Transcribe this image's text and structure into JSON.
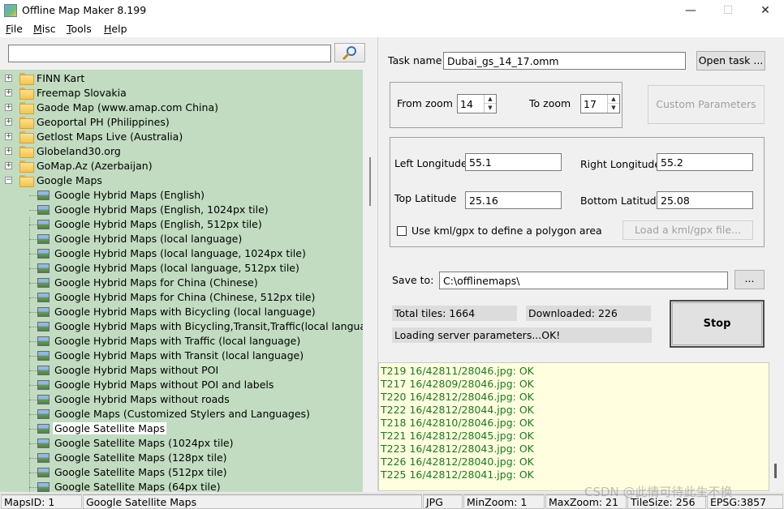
{
  "window": {
    "title": "Offline Map Maker 8.199",
    "minimize": "—",
    "maximize": "☐",
    "close": "✕"
  },
  "menu": [
    {
      "label": "File",
      "accel": "F",
      "rest": "ile"
    },
    {
      "label": "Misc",
      "accel": "M",
      "rest": "isc"
    },
    {
      "label": "Tools",
      "accel": "T",
      "rest": "ools"
    },
    {
      "label": "Help",
      "accel": "H",
      "rest": "elp"
    }
  ],
  "search": {
    "value": "",
    "button_icon": "magnifier-icon"
  },
  "tree": {
    "folders": [
      {
        "label": "FINN Kart",
        "expander": "+"
      },
      {
        "label": "Freemap Slovakia",
        "expander": "+"
      },
      {
        "label": "Gaode Map (www.amap.com China)",
        "expander": "+"
      },
      {
        "label": "Geoportal PH (Philippines)",
        "expander": "+"
      },
      {
        "label": "Getlost Maps Live (Australia)",
        "expander": "+"
      },
      {
        "label": "Globeland30.org",
        "expander": "+"
      },
      {
        "label": "GoMap.Az (Azerbaijan)",
        "expander": "+"
      },
      {
        "label": "Google Maps",
        "expander": "−"
      }
    ],
    "items": [
      "Google Hybrid Maps (English)",
      "Google Hybrid Maps (English, 1024px tile)",
      "Google Hybrid Maps (English, 512px tile)",
      "Google Hybrid Maps (local language)",
      "Google Hybrid Maps (local language, 1024px tile)",
      "Google Hybrid Maps (local language, 512px tile)",
      "Google Hybrid Maps for China (Chinese)",
      "Google Hybrid Maps for China (Chinese, 512px tile)",
      "Google Hybrid Maps with Bicycling (local language)",
      "Google Hybrid Maps with Bicycling,Transit,Traffic(local language)",
      "Google Hybrid Maps with Traffic (local language)",
      "Google Hybrid Maps with Transit (local language)",
      "Google Hybrid Maps without POI",
      "Google Hybrid Maps without POI and labels",
      "Google Hybrid Maps without roads",
      "Google Maps (Customized Stylers and Languages)",
      "Google Satellite Maps",
      "Google Satellite Maps (1024px tile)",
      "Google Satellite Maps (128px tile)",
      "Google Satellite Maps (512px tile)",
      "Google Satellite Maps (64px tile)"
    ],
    "selected": "Google Satellite Maps"
  },
  "task": {
    "name_label": "Task name",
    "name_value": "Dubai_gs_14_17.omm",
    "open_button": "Open task ..."
  },
  "zoom": {
    "from_label": "From zoom",
    "from_value": "14",
    "to_label": "To zoom",
    "to_value": "17",
    "custom_button": "Custom Parameters"
  },
  "area": {
    "left_lon_label": "Left Longitude",
    "left_lon_value": "55.1",
    "right_lon_label": "Right Longitude",
    "right_lon_value": "55.2",
    "top_lat_label": "Top Latitude",
    "top_lat_value": "25.16",
    "bottom_lat_label": "Bottom Latitude",
    "bottom_lat_value": "25.08",
    "kml_checkbox_label": "Use kml/gpx to define a polygon area",
    "kml_checked": false,
    "load_kml_button": "Load a kml/gpx file..."
  },
  "save": {
    "label": "Save to:",
    "value": "C:\\offlinemaps\\",
    "browse_button": "..."
  },
  "stats": {
    "total_tiles": "Total tiles: 1664",
    "downloaded": "Downloaded: 226",
    "status": "Loading server parameters...OK!",
    "stop_button": "Stop"
  },
  "log": [
    "T219 16/42811/28046.jpg: OK",
    "T217 16/42809/28046.jpg: OK",
    "T220 16/42812/28046.jpg: OK",
    "T222 16/42812/28044.jpg: OK",
    "T218 16/42810/28046.jpg: OK",
    "T221 16/42812/28045.jpg: OK",
    "T223 16/42812/28043.jpg: OK",
    "T226 16/42812/28040.jpg: OK",
    "T225 16/42812/28041.jpg: OK"
  ],
  "statusbar": {
    "maps_id": "MapsID: 1",
    "map_name": "Google Satellite Maps",
    "format": "JPG",
    "min_zoom": "MinZoom: 1",
    "max_zoom": "MaxZoom: 21",
    "tile_size": "TileSize: 256",
    "epsg": "EPSG:3857"
  },
  "watermark": "CSDN @此情可待此生不换"
}
